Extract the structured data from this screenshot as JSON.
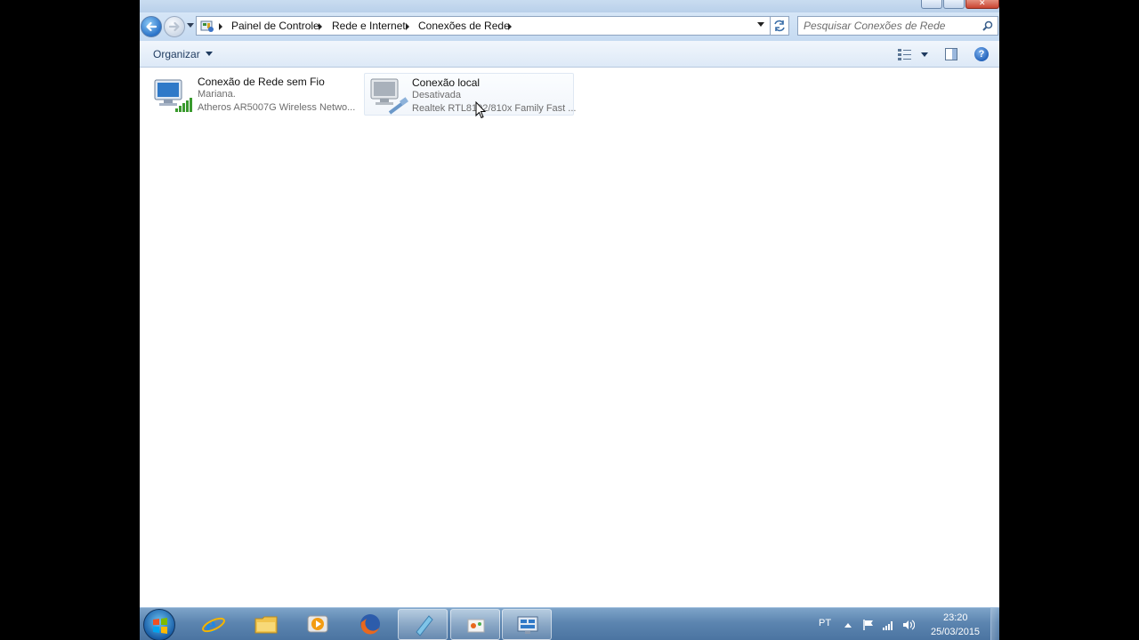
{
  "breadcrumb": {
    "items": [
      "Painel de Controle",
      "Rede e Internet",
      "Conexões de Rede"
    ]
  },
  "search": {
    "placeholder": "Pesquisar Conexões de Rede"
  },
  "toolbar": {
    "organize_label": "Organizar",
    "help_label": "?"
  },
  "connections": [
    {
      "name": "Conexão de Rede sem Fio",
      "status": "Mariana.",
      "device": "Atheros AR5007G Wireless Netwo...",
      "icon": "wireless-network-icon"
    },
    {
      "name": "Conexão local",
      "status": "Desativada",
      "device": "Realtek RTL8102/810x Family Fast ...",
      "icon": "wired-network-icon"
    }
  ],
  "taskbar": {
    "apps": [
      "internet-explorer",
      "windows-explorer",
      "media-player",
      "firefox",
      "paint",
      "windows-media-center",
      "control-panel"
    ],
    "language": "PT",
    "time": "23:20",
    "date": "25/03/2015"
  },
  "colors": {
    "accent": "#2a73c9",
    "taskbar": "#5c85b0",
    "wifi_signal": "#3a9a2e"
  }
}
